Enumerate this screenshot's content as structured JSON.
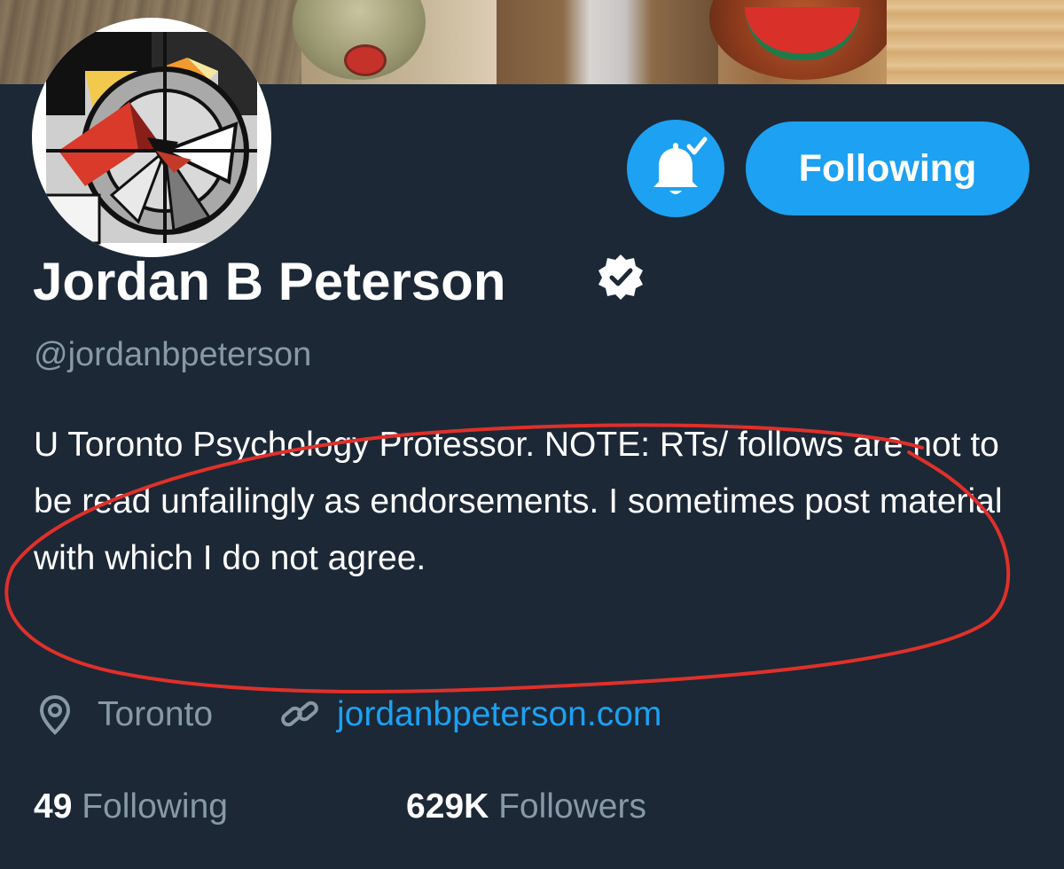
{
  "profile": {
    "display_name": "Jordan B Peterson",
    "handle": "@jordanbpeterson",
    "bio": "U Toronto Psychology Professor. NOTE: RTs/ follows are not to be read unfailingly as endorsements. I sometimes post material with which I do not agree.",
    "location": "Toronto",
    "website": "jordanbpeterson.com",
    "verified": true
  },
  "actions": {
    "notifications_icon": "bell-check-icon",
    "follow_label": "Following"
  },
  "stats": {
    "following_count": "49",
    "following_label": "Following",
    "followers_count": "629K",
    "followers_label": "Followers"
  },
  "icons": {
    "location": "location-pin-icon",
    "link": "link-icon",
    "verified": "verified-badge-icon"
  },
  "colors": {
    "background": "#1c2836",
    "accent": "#1da1f2",
    "secondary_text": "#8899a6",
    "annotation": "#e0302a"
  }
}
